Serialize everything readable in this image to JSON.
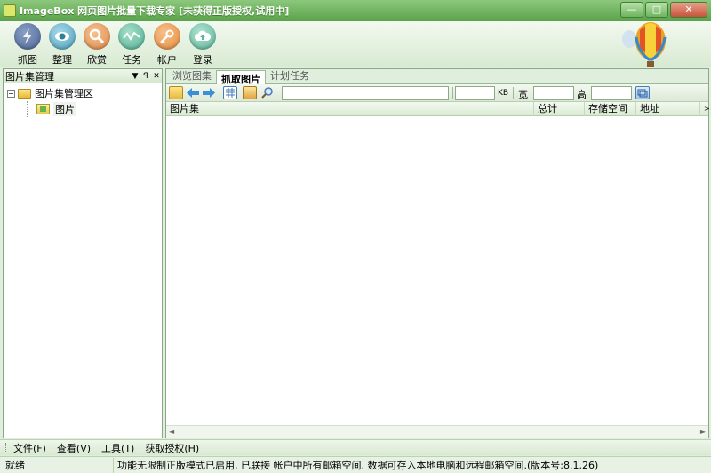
{
  "window": {
    "title": "ImageBox 网页图片批量下载专家 [未获得正版授权,试用中]",
    "controls": [
      "—",
      "□",
      "✕"
    ]
  },
  "toolbar": {
    "items": [
      {
        "label": "抓图",
        "icon": "lightning-icon"
      },
      {
        "label": "整理",
        "icon": "eye-icon"
      },
      {
        "label": "欣赏",
        "icon": "magnifier-icon"
      },
      {
        "label": "任务",
        "icon": "wave-icon"
      },
      {
        "label": "帐户",
        "icon": "key-icon"
      },
      {
        "label": "登录",
        "icon": "cloud-upload-icon"
      }
    ]
  },
  "left_panel": {
    "title": "图片集管理",
    "header_buttons": [
      "▼",
      "ꟼ",
      "✕"
    ],
    "tree": {
      "root": {
        "label": "图片集管理区",
        "expander": "−"
      },
      "child": {
        "label": "图片"
      }
    }
  },
  "tabs": [
    {
      "label": "浏览图集",
      "active": false
    },
    {
      "label": "抓取图片",
      "active": true
    },
    {
      "label": "计划任务",
      "active": false
    }
  ],
  "url_bar": {
    "url_value": "",
    "size_value": "",
    "size_unit": "KB",
    "width_label": "宽",
    "width_value": "",
    "height_label": "高",
    "height_value": ""
  },
  "table": {
    "columns": [
      "图片集",
      "总计",
      "存储空间",
      "地址",
      ">"
    ]
  },
  "menu": {
    "items": [
      "文件(F)",
      "查看(V)",
      "工具(T)",
      "获取授权(H)"
    ]
  },
  "status": {
    "left": "就绪",
    "message": "功能无限制正版模式已启用, 已联接 帐户中所有邮箱空间. 数据可存入本地电脑和远程邮箱空间.(版本号:8.1.26)"
  },
  "colors": {
    "titlebar": "#5aa24a",
    "panel_border": "#8aa886",
    "background": "#dfeedd"
  }
}
